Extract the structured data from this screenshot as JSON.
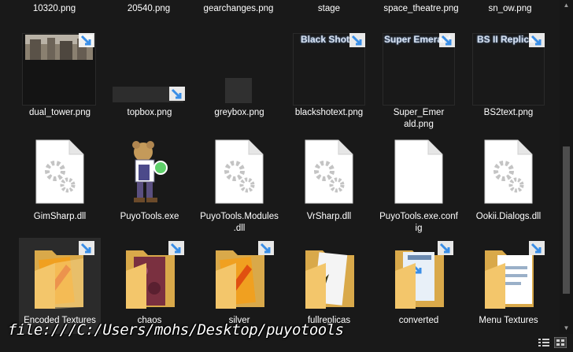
{
  "row1": [
    "10320.png",
    "20540.png",
    "gearchanges.png",
    "stage",
    "space_theatre.png",
    "sn_ow.png"
  ],
  "row2": {
    "items": [
      "dual_tower.png",
      "topbox.png",
      "greybox.png",
      "blackshotext.png",
      "Super_Emerald.png",
      "BS2text.png"
    ],
    "thumb_texts": [
      "Black Shot",
      "Super Emerald",
      "BS II Replica"
    ]
  },
  "row3": [
    "GimSharp.dll",
    "PuyoTools.exe",
    "PuyoTools.Modules.dll",
    "VrSharp.dll",
    "PuyoTools.exe.config",
    "Ookii.Dialogs.dll"
  ],
  "row4": [
    "Encoded Textures",
    "chaos",
    "silver",
    "fullreplicas",
    "converted",
    "Menu Textures"
  ],
  "overlay_url": "file:///C:/Users/mohs/Desktop/puyotools",
  "colors": {
    "background": "#191919",
    "selected": "#2b2b2b",
    "folder": "#f3c66b",
    "shortcut": "#3a8ee6"
  }
}
